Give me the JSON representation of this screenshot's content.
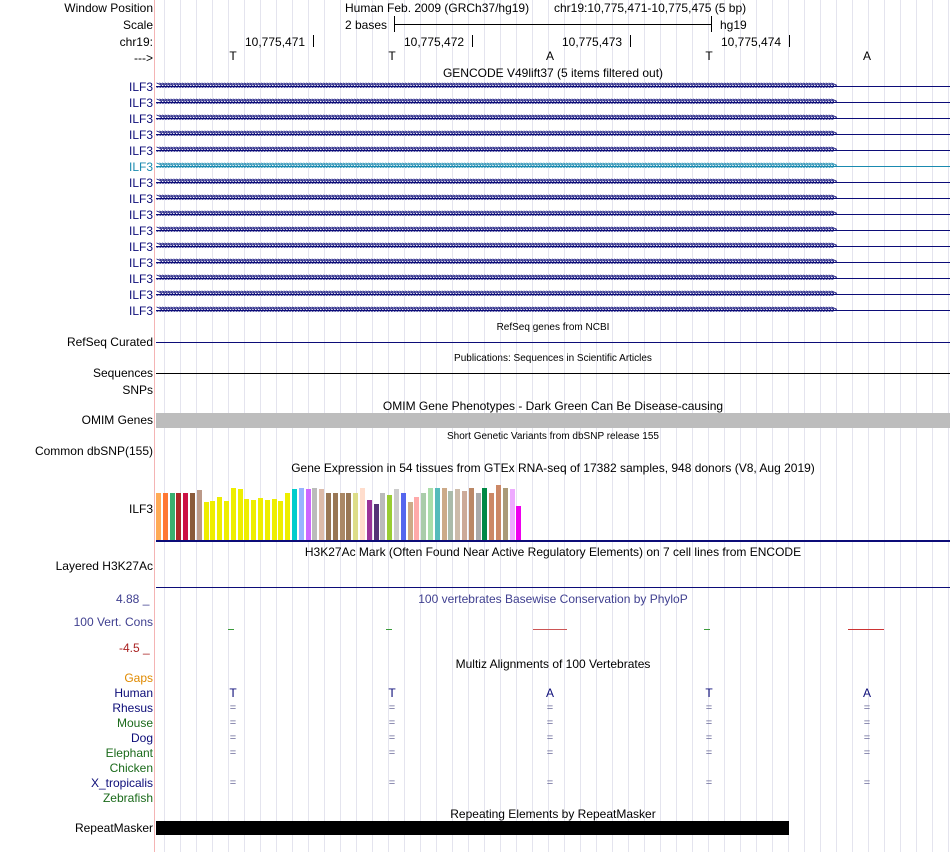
{
  "header": {
    "window_position_label": "Window Position",
    "scale_label": "Scale",
    "chrom_label": "chr19:",
    "strand_label": "--->",
    "assembly": "Human Feb. 2009 (GRCh37/hg19)",
    "position": "chr19:10,775,471-10,775,475 (5 bp)",
    "scale_text": "2 bases",
    "scale_db": "hg19",
    "ticks": [
      "10,775,471",
      "10,775,472",
      "10,775,473",
      "10,775,474"
    ],
    "bases": [
      "T",
      "T",
      "A",
      "T",
      "A"
    ]
  },
  "gencode": {
    "title": "GENCODE V49lift37 (5 items filtered out)",
    "rows": [
      "ILF3",
      "ILF3",
      "ILF3",
      "ILF3",
      "ILF3",
      "ILF3",
      "ILF3",
      "ILF3",
      "ILF3",
      "ILF3",
      "ILF3",
      "ILF3",
      "ILF3",
      "ILF3",
      "ILF3"
    ],
    "highlight_index": 5,
    "color": "#0c0c78",
    "highlight_color": "#1a8ab0"
  },
  "refseq": {
    "title": "RefSeq genes from NCBI",
    "label": "RefSeq Curated",
    "color": "#0c0c78"
  },
  "publications": {
    "title": "Publications: Sequences in Scientific Articles",
    "label": "Sequences"
  },
  "snps_label": "SNPs",
  "omim": {
    "title": "OMIM Gene Phenotypes - Dark Green Can Be Disease-causing",
    "label": "OMIM Genes",
    "color": "#1a6a1a"
  },
  "dbsnp": {
    "title": "Short Genetic Variants from dbSNP release 155",
    "label": "Common dbSNP(155)"
  },
  "gtex": {
    "title": "Gene Expression in 54 tissues from GTEx RNA-seq of 17382 samples, 948 donors (V8, Aug 2019)",
    "label": "ILF3",
    "heights": [
      0.73,
      0.73,
      0.72,
      0.73,
      0.73,
      0.73,
      0.77,
      0.58,
      0.6,
      0.66,
      0.6,
      0.8,
      0.78,
      0.63,
      0.62,
      0.64,
      0.62,
      0.63,
      0.6,
      0.72,
      0.78,
      0.8,
      0.78,
      0.8,
      0.78,
      0.73,
      0.73,
      0.73,
      0.73,
      0.73,
      0.8,
      0.61,
      0.55,
      0.73,
      0.7,
      0.78,
      0.73,
      0.58,
      0.66,
      0.73,
      0.8,
      0.8,
      0.8,
      0.75,
      0.78,
      0.76,
      0.8,
      0.73,
      0.8,
      0.73,
      0.85,
      0.8,
      0.78,
      0.53
    ],
    "colors": [
      "#ffaa55",
      "#ff7733",
      "#38b070",
      "#aa2828",
      "#cc1144",
      "#8a5a3a",
      "#bb9988",
      "#eeee00",
      "#eeee00",
      "#eeee00",
      "#eeee00",
      "#eeee00",
      "#eeee00",
      "#eeee00",
      "#eeee00",
      "#eeee00",
      "#eeee00",
      "#eeee00",
      "#eeee00",
      "#eeee00",
      "#00cccc",
      "#99b3ff",
      "#cc66ff",
      "#bbbbbb",
      "#ddbbaa",
      "#997755",
      "#997755",
      "#aa8866",
      "#997755",
      "#dddd88",
      "#ffddcc",
      "#993399",
      "#553377",
      "#bbbbbb",
      "#99cc33",
      "#cccccc",
      "#5566ee",
      "#ccaa88",
      "#ffaaaa",
      "#aaccaa",
      "#aaddaa",
      "#55bbbb",
      "#ccaa88",
      "#aabbaa",
      "#ccbbaa",
      "#ccaa99",
      "#bb8866",
      "#aaaaaa",
      "#008844",
      "#cc8866",
      "#cc8866",
      "#aa9977",
      "#eeaaff",
      "#ee00ee"
    ]
  },
  "h3k27ac": {
    "title": "H3K27Ac Mark (Often Found Near Active Regulatory Elements) on 7 cell lines from ENCODE",
    "label": "Layered H3K27Ac"
  },
  "phylop": {
    "title": "100 vertebrates Basewise Conservation by PhyloP",
    "label": "100 Vert. Cons",
    "max": "4.88 _",
    "min": "-4.5 _",
    "title_color": "#404090",
    "label_color": "#404090",
    "max_color": "#404090",
    "min_color": "#aa2222"
  },
  "multiz": {
    "title": "Multiz Alignments of 100 Vertebrates",
    "gaps_label": "Gaps",
    "species": [
      {
        "name": "Human",
        "color": "#0c0c78"
      },
      {
        "name": "Rhesus",
        "color": "#0c0c78"
      },
      {
        "name": "Mouse",
        "color": "#1a6a1a"
      },
      {
        "name": "Dog",
        "color": "#0c0c78"
      },
      {
        "name": "Elephant",
        "color": "#1a6a1a"
      },
      {
        "name": "Chicken",
        "color": "#1a6a1a"
      },
      {
        "name": "X_tropicalis",
        "color": "#0c0c78"
      },
      {
        "name": "Zebrafish",
        "color": "#1a6a1a"
      }
    ],
    "human_bases": [
      "T",
      "T",
      "A",
      "T",
      "A"
    ],
    "match_symbol": "=",
    "gaps_color": "#e08a00"
  },
  "repeatmasker": {
    "title": "Repeating Elements by RepeatMasker",
    "label": "RepeatMasker"
  }
}
